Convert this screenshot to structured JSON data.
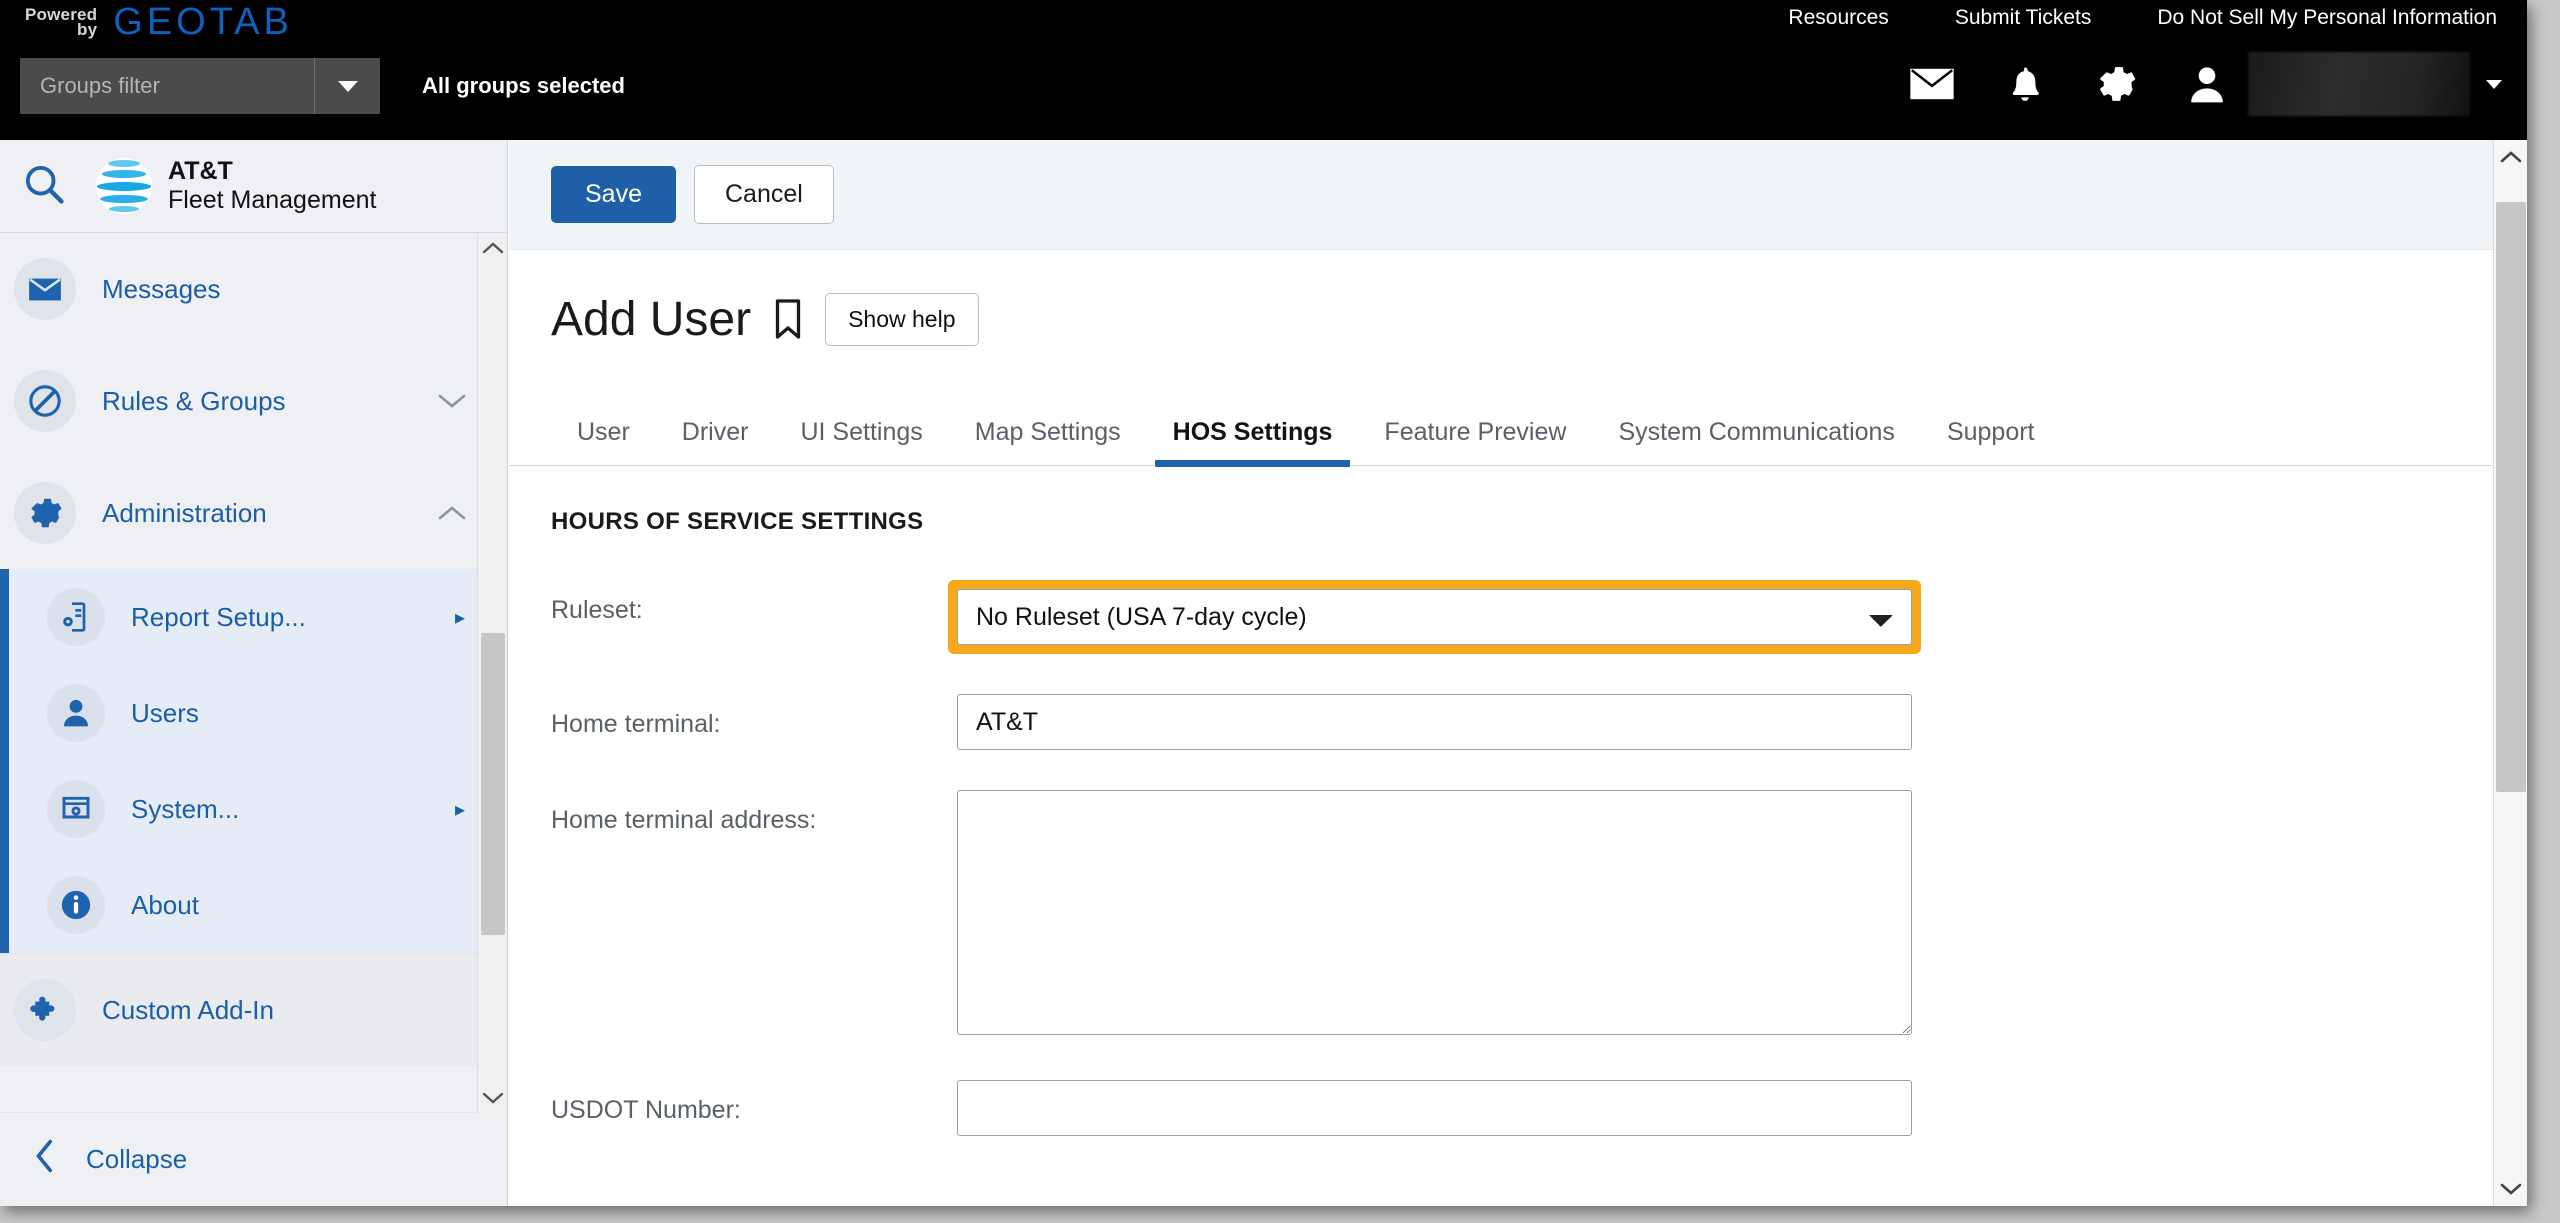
{
  "topbar": {
    "powered_line1": "Powered",
    "powered_line2": "by",
    "brand": "GEOTAB",
    "links": [
      {
        "label": "Resources"
      },
      {
        "label": "Submit Tickets"
      },
      {
        "label": "Do Not Sell My Personal Information"
      }
    ],
    "groups_filter_placeholder": "Groups filter",
    "groups_status": "All groups selected",
    "icons": [
      "mail-icon",
      "bell-icon",
      "gear-icon",
      "person-icon"
    ],
    "user_name": ""
  },
  "sidebar": {
    "search_icon": "search-icon",
    "logo": {
      "title": "AT&T",
      "subtitle": "Fleet Management"
    },
    "items": [
      {
        "label": "Messages",
        "icon": "mail-icon",
        "expander": ""
      },
      {
        "label": "Rules & Groups",
        "icon": "prohibit-icon",
        "expander": "chevron-down"
      },
      {
        "label": "Administration",
        "icon": "gear-icon",
        "expander": "chevron-up"
      }
    ],
    "subitems": [
      {
        "label": "Report Setup...",
        "icon": "report-setup-icon",
        "arrow": "▸"
      },
      {
        "label": "Users",
        "icon": "person-icon",
        "arrow": ""
      },
      {
        "label": "System...",
        "icon": "system-icon",
        "arrow": "▸"
      },
      {
        "label": "About",
        "icon": "info-icon",
        "arrow": ""
      }
    ],
    "addin": {
      "label": "Custom Add-In",
      "icon": "puzzle-icon"
    },
    "collapse": {
      "label": "Collapse",
      "icon": "chevron-left-icon"
    }
  },
  "main": {
    "actions": {
      "save": "Save",
      "cancel": "Cancel"
    },
    "title": "Add User",
    "bookmark_icon": "bookmark-icon",
    "help_button": "Show help",
    "tabs": [
      {
        "label": "User",
        "active": false
      },
      {
        "label": "Driver",
        "active": false
      },
      {
        "label": "UI Settings",
        "active": false
      },
      {
        "label": "Map Settings",
        "active": false
      },
      {
        "label": "HOS Settings",
        "active": true
      },
      {
        "label": "Feature Preview",
        "active": false
      },
      {
        "label": "System Communications",
        "active": false
      },
      {
        "label": "Support",
        "active": false
      }
    ],
    "section_title": "HOURS OF SERVICE SETTINGS",
    "fields": {
      "ruleset": {
        "label": "Ruleset:",
        "value": "No Ruleset (USA 7-day cycle)",
        "highlighted": true,
        "highlight_color": "#f5a81c",
        "options": [
          "No Ruleset (USA 7-day cycle)"
        ]
      },
      "home_terminal": {
        "label": "Home terminal:",
        "value": "AT&T"
      },
      "home_terminal_address": {
        "label": "Home terminal address:",
        "value": ""
      },
      "usdot_number": {
        "label": "USDOT Number:",
        "value": ""
      }
    }
  },
  "colors": {
    "accent_blue": "#1f62ad",
    "highlight_orange": "#f5a81c",
    "geotab_blue": "#0f5fbd",
    "att_cyan": "#2ab0e8"
  }
}
